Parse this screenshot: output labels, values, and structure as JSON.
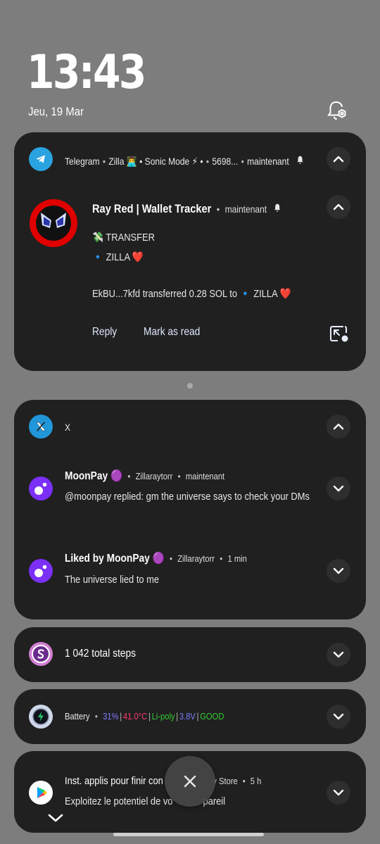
{
  "status": {
    "time": "13:43",
    "date": "Jeu, 19 Mar"
  },
  "telegram": {
    "app": "Telegram",
    "chat": "Zilla 👨‍💻 • Sonic Mode ⚡ •",
    "extra": "5698...",
    "time": "maintenant",
    "sender": "Ray Red | Wallet Tracker",
    "sender_time": "maintenant",
    "line1": "💸 TRANSFER",
    "line2": "🔹 ZILLA ❤️",
    "line3": "EkBU...7kfd transferred 0.28 SOL to 🔹 ZILLA ❤️",
    "reply": "Reply",
    "mark_read": "Mark as read"
  },
  "x": {
    "app": "X",
    "n1_title": "MoonPay 🟣",
    "n1_account": "Zillaraytorr",
    "n1_time": "maintenant",
    "n1_body": "@moonpay replied: gm the universe says to check your DMs",
    "n2_title": "Liked by MoonPay 🟣",
    "n2_account": "Zillaraytorr",
    "n2_time": "1 min",
    "n2_body": "The universe lied to me"
  },
  "steps": {
    "text": "1 042 total steps"
  },
  "battery": {
    "app": "Battery",
    "pct": "31%",
    "temp": "41.0°C",
    "type": "Li-poly",
    "volt": "3.8V",
    "health": "GOOD",
    "sep": "|",
    "colors": {
      "pct": "#7b7bff",
      "temp": "#ff3b6b",
      "type": "#33cc33",
      "volt": "#7b7bff",
      "health": "#33cc33"
    }
  },
  "play": {
    "title_start": "Inst. applis pour finir con",
    "title_end": "y Store",
    "time": "5 h",
    "body_start": "Exploitez le potentiel de vo",
    "body_end": "pareil"
  }
}
